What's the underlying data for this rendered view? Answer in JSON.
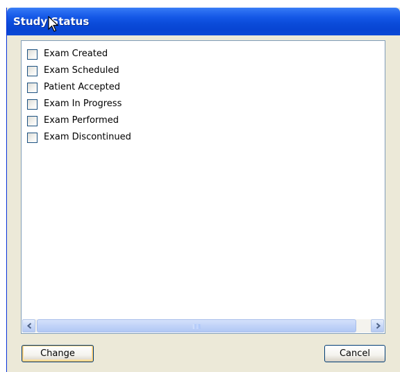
{
  "window": {
    "title": "Study Status"
  },
  "status_list": {
    "items": [
      {
        "label": "Exam Created",
        "checked": false
      },
      {
        "label": "Exam Scheduled",
        "checked": false
      },
      {
        "label": "Patient Accepted",
        "checked": false
      },
      {
        "label": "Exam In Progress",
        "checked": false
      },
      {
        "label": "Exam Performed",
        "checked": false
      },
      {
        "label": "Exam Discontinued",
        "checked": false
      }
    ]
  },
  "buttons": {
    "change_label": "Change",
    "cancel_label": "Cancel"
  },
  "colors": {
    "titlebar": "#0a4ad8",
    "dialog_bg": "#ece9d8",
    "list_border": "#7f9db9",
    "checkbox_border": "#1c5180"
  },
  "icons": {
    "cursor": "arrow-cursor-icon",
    "scroll_left": "scroll-left-arrow-icon",
    "scroll_right": "scroll-right-arrow-icon"
  }
}
